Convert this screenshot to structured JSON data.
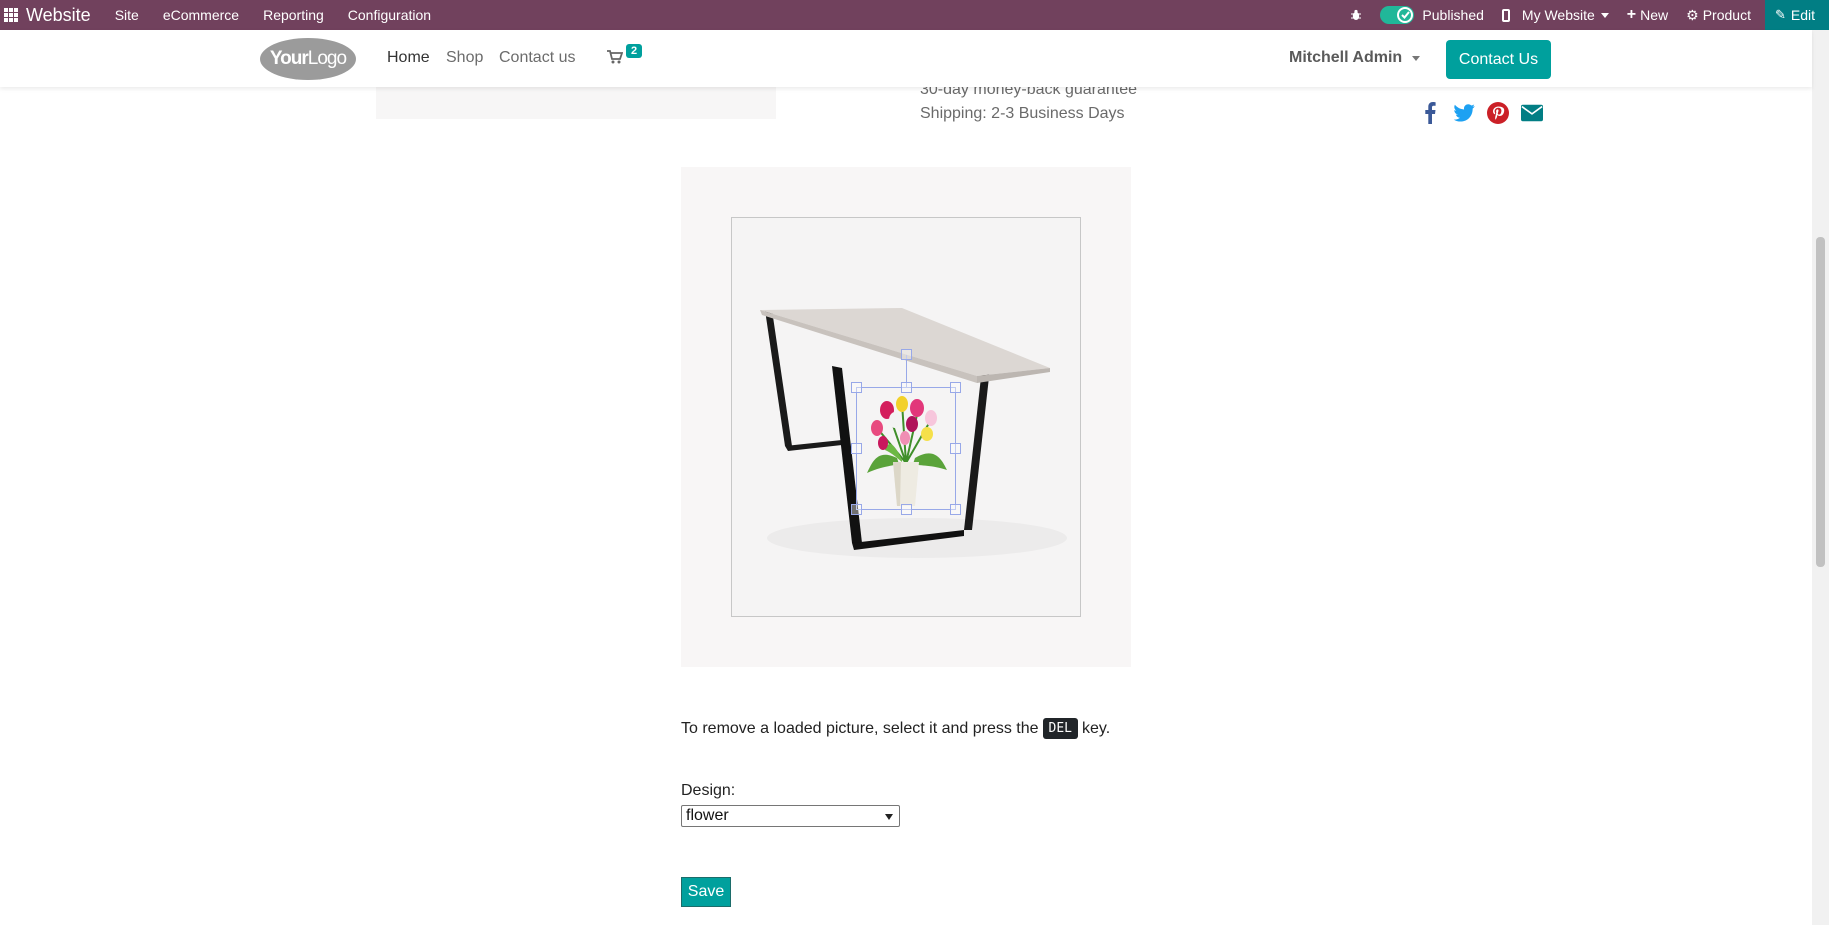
{
  "admin_bar": {
    "brand": "Website",
    "menu": [
      "Site",
      "eCommerce",
      "Reporting",
      "Configuration"
    ],
    "published_label": "Published",
    "my_website_label": "My Website",
    "new_label": "New",
    "product_label": "Product",
    "edit_label": "Edit",
    "bg_color": "#71415d"
  },
  "header": {
    "logo_bold": "Your",
    "logo_regular": "Logo",
    "nav": [
      "Home",
      "Shop",
      "Contact us"
    ],
    "cart_count": "2",
    "user_name": "Mitchell Admin",
    "contact_button": "Contact Us",
    "accent_color": "#00a09d"
  },
  "product_info": {
    "guarantee": "30-day money-back guarantee",
    "shipping": "Shipping: 2-3 Business Days"
  },
  "social_icons": [
    "facebook-icon",
    "twitter-icon",
    "pinterest-icon",
    "envelope-icon"
  ],
  "editor": {
    "instructions_before": "To remove a loaded picture, select it and press the",
    "key": "DEL",
    "instructions_after": "key.",
    "design_label": "Design:",
    "design_value": "flower",
    "save_label": "Save"
  }
}
